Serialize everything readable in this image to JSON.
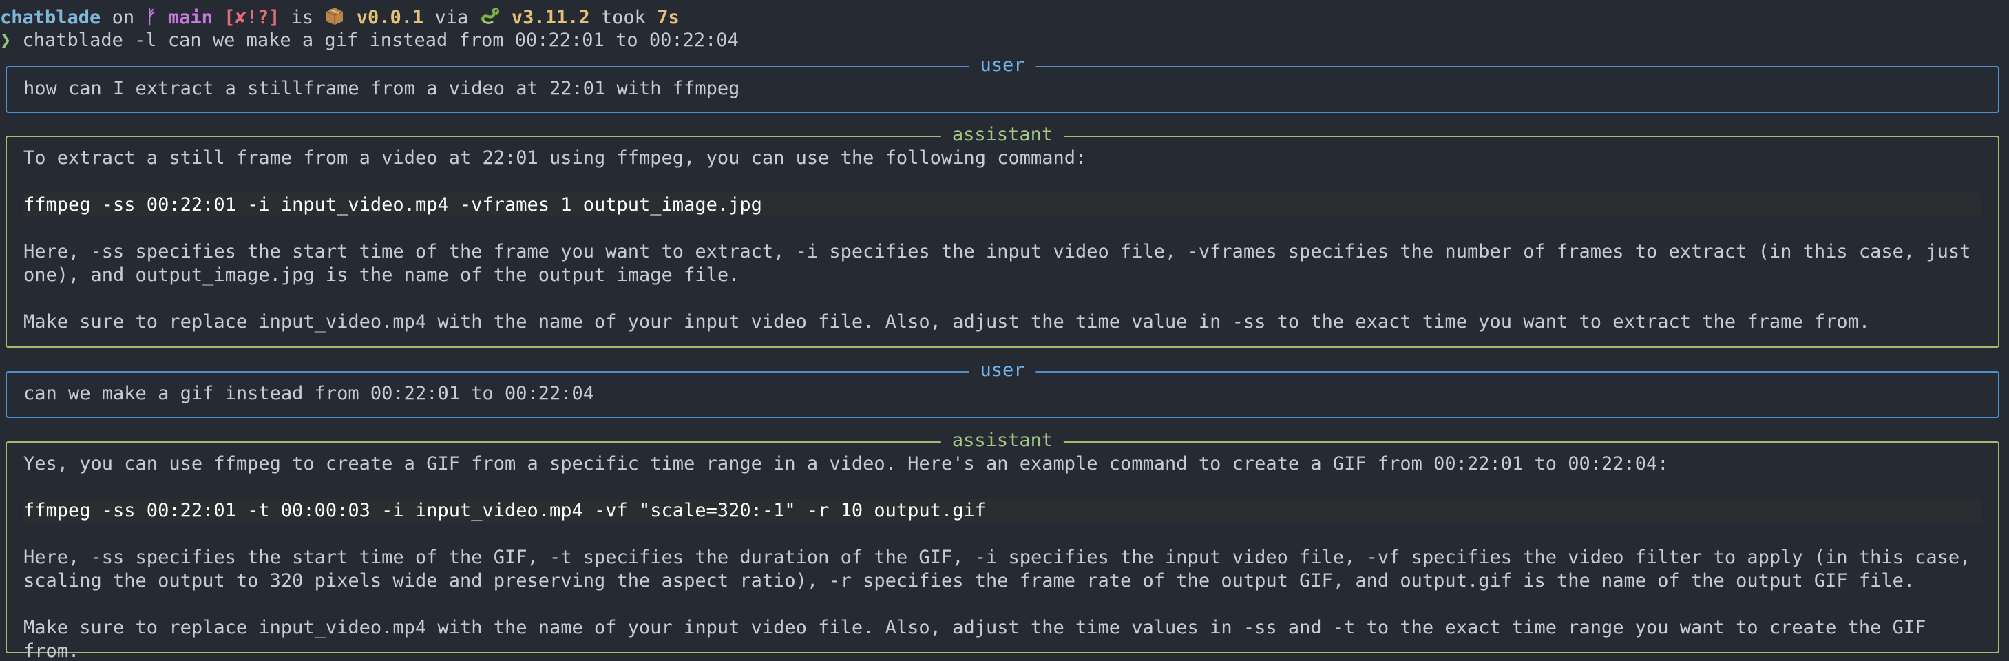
{
  "prompt": {
    "dir": "chatblade",
    "on": "on",
    "branch_glyph": "ᚠ",
    "branch": "main",
    "status": "[✘!?]",
    "is": "is",
    "package_icon": "package-icon",
    "version": "v0.0.1",
    "via": "via",
    "python_icon": "python-icon",
    "py_version": "v3.11.2",
    "took": "took",
    "duration": "7s"
  },
  "command": {
    "chevron": "❯",
    "text": "chatblade -l can we make a gif instead from 00:22:01 to 00:22:04"
  },
  "messages": [
    {
      "role": "user",
      "paragraphs": [
        "how can I extract a stillframe from a video at 22:01 with ffmpeg"
      ]
    },
    {
      "role": "assistant",
      "intro": "To extract a still frame from a video at 22:01 using ffmpeg, you can use the following command:",
      "code": "ffmpeg -ss 00:22:01 -i input_video.mp4 -vframes 1 output_image.jpg",
      "explanation": "Here, -ss specifies the start time of the frame you want to extract, -i specifies the input video file, -vframes specifies the number of frames to extract (in this case, just\none), and output_image.jpg is the name of the output image file.",
      "outro": "Make sure to replace input_video.mp4 with the name of your input video file. Also, adjust the time value in -ss to the exact time you want to extract the frame from."
    },
    {
      "role": "user",
      "paragraphs": [
        "can we make a gif instead from 00:22:01 to 00:22:04"
      ]
    },
    {
      "role": "assistant",
      "intro": "Yes, you can use ffmpeg to create a GIF from a specific time range in a video. Here's an example command to create a GIF from 00:22:01 to 00:22:04:",
      "code": "ffmpeg -ss 00:22:01 -t 00:00:03 -i input_video.mp4 -vf \"scale=320:-1\" -r 10 output.gif",
      "explanation": "Here, -ss specifies the start time of the GIF, -t specifies the duration of the GIF, -i specifies the input video file, -vf specifies the video filter to apply (in this case,\nscaling the output to 320 pixels wide and preserving the aspect ratio), -r specifies the frame rate of the output GIF, and output.gif is the name of the output GIF file.",
      "outro": "Make sure to replace input_video.mp4 with the name of your input video file. Also, adjust the time values in -ss and -t to the exact time range you want to create the GIF from."
    }
  ],
  "colors": {
    "background": "#262a33",
    "text": "#c7cbd3",
    "user_border": "#4f8fd0",
    "assistant_border": "#9bbf6d"
  }
}
